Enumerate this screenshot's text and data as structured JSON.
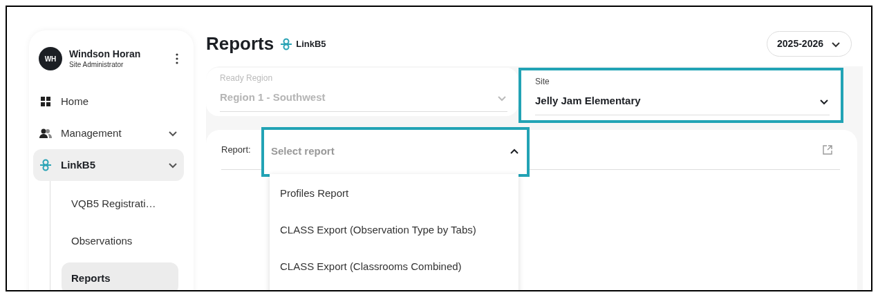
{
  "user": {
    "initials": "WH",
    "name": "Windson Horan",
    "role": "Site Administrator"
  },
  "nav": [
    {
      "label": "Home",
      "kind": "home",
      "selected": false
    },
    {
      "label": "Management",
      "kind": "people",
      "selected": false,
      "collapsible": true
    },
    {
      "label": "LinkB5",
      "kind": "link",
      "selected": true,
      "collapsible": true,
      "children": [
        {
          "label": "VQB5 Registrati…",
          "selected": false
        },
        {
          "label": "Observations",
          "selected": false
        },
        {
          "label": "Reports",
          "selected": true
        }
      ]
    }
  ],
  "header": {
    "title": "Reports",
    "brand": "LinkB5",
    "year": "2025-2026"
  },
  "filters": [
    {
      "label": "Ready Region",
      "value": "Region 1 - Southwest",
      "disabled": true,
      "highlighted": false
    },
    {
      "label": "Site",
      "value": "Jelly Jam Elementary",
      "disabled": false,
      "highlighted": true
    }
  ],
  "report": {
    "label": "Report:",
    "placeholder": "Select report",
    "expanded": true,
    "highlighted": true,
    "options": [
      {
        "label": "Profiles Report"
      },
      {
        "label": "CLASS Export (Observation Type by Tabs)"
      },
      {
        "label": "CLASS Export (Classrooms Combined)"
      }
    ]
  }
}
